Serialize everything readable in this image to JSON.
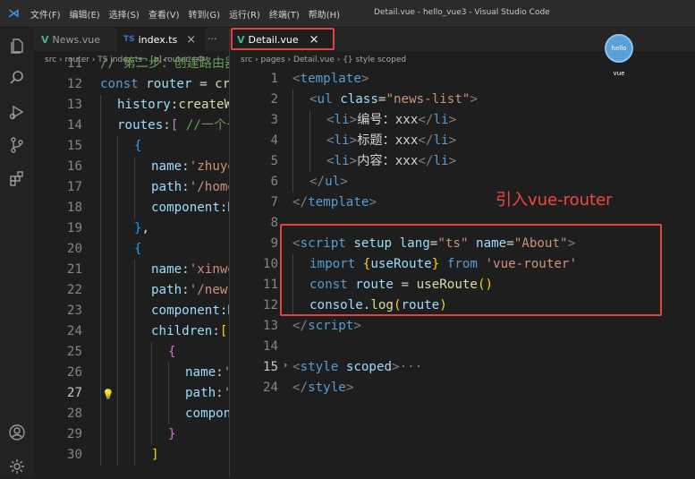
{
  "titlebar": {
    "menu": [
      "文件(F)",
      "编辑(E)",
      "选择(S)",
      "查看(V)",
      "转到(G)",
      "运行(R)",
      "终端(T)",
      "帮助(H)"
    ],
    "window_title": "Detail.vue - hello_vue3 - Visual Studio Code"
  },
  "left_pane": {
    "tabs": [
      {
        "label": "News.vue"
      },
      {
        "label": "index.ts"
      }
    ],
    "tab_close": "×",
    "tab_more": "···",
    "breadcrumb": "src › router › TS index.ts › [ø] router › ⚙",
    "lines": [
      {
        "n": "11",
        "indent": 0,
        "html": "<span class='cm'>// 第二步：创建路由器</span>"
      },
      {
        "n": "12",
        "indent": 0,
        "html": "<span class='kw'>const</span> <span class='vr'>router</span> <span class='wt'>=</span> <span class='fn'>createRouter</span>"
      },
      {
        "n": "13",
        "indent": 1,
        "html": "<span class='vr'>history</span><span class='wt'>:</span><span class='fn'>createWebHistory</span>"
      },
      {
        "n": "14",
        "indent": 1,
        "html": "<span class='vr'>routes</span><span class='wt'>:</span><span class='br2'>[</span> <span class='cm'>//一个一个的路由规则</span>"
      },
      {
        "n": "15",
        "indent": 2,
        "html": "<span class='br3'>{</span>"
      },
      {
        "n": "16",
        "indent": 3,
        "html": "<span class='vr'>name</span><span class='wt'>:</span><span class='st'>'zhuye'</span>"
      },
      {
        "n": "17",
        "indent": 3,
        "html": "<span class='vr'>path</span><span class='wt'>:</span><span class='st'>'/home'</span>"
      },
      {
        "n": "18",
        "indent": 3,
        "html": "<span class='vr'>component</span><span class='wt'>:</span><span class='vr'>Home</span>"
      },
      {
        "n": "19",
        "indent": 2,
        "html": "<span class='br3'>}</span><span class='wt'>,</span>"
      },
      {
        "n": "20",
        "indent": 2,
        "html": "<span class='br3'>{</span>"
      },
      {
        "n": "21",
        "indent": 3,
        "html": "<span class='vr'>name</span><span class='wt'>:</span><span class='st'>'xinwen'</span>"
      },
      {
        "n": "22",
        "indent": 3,
        "html": "<span class='vr'>path</span><span class='wt'>:</span><span class='st'>'/news'</span>"
      },
      {
        "n": "23",
        "indent": 3,
        "html": "<span class='vr'>component</span><span class='wt'>:</span><span class='vr'>News</span>"
      },
      {
        "n": "24",
        "indent": 3,
        "html": "<span class='vr'>children</span><span class='wt'>:</span><span class='br1'>[</span>"
      },
      {
        "n": "25",
        "indent": 4,
        "html": "<span class='br2'>{</span>"
      },
      {
        "n": "26",
        "indent": 5,
        "html": "<span class='vr'>name</span><span class='wt'>:</span><span class='st'>'xiang'</span>"
      },
      {
        "n": "27",
        "indent": 5,
        "html": "<span class='vr'>path</span><span class='wt'>:</span><span class='st'>'detail'</span>"
      },
      {
        "n": "28",
        "indent": 5,
        "html": "<span class='vr'>component</span><span class='wt'>:</span><span class='vr'>Detail</span>"
      },
      {
        "n": "29",
        "indent": 4,
        "html": "<span class='br2'>}</span>"
      },
      {
        "n": "30",
        "indent": 3,
        "html": "<span class='br1'>]</span>"
      }
    ]
  },
  "right_pane": {
    "tab": {
      "label": "Detail.vue"
    },
    "tab_close": "×",
    "breadcrumb": "src › pages › Detail.vue › {} style scoped",
    "lines": [
      {
        "n": "1",
        "indent": 0,
        "html": "<span class='pn'>&lt;</span><span class='tg'>template</span><span class='pn'>&gt;</span>"
      },
      {
        "n": "2",
        "indent": 1,
        "html": "<span class='pn'>&lt;</span><span class='tg'>ul</span> <span class='at'>class</span><span class='wt'>=</span><span class='st'>\"news-list\"</span><span class='pn'>&gt;</span>"
      },
      {
        "n": "3",
        "indent": 2,
        "html": "<span class='pn'>&lt;</span><span class='tg'>li</span><span class='pn'>&gt;</span><span class='wt'>编号：xxx</span><span class='pn'>&lt;/</span><span class='tg'>li</span><span class='pn'>&gt;</span>"
      },
      {
        "n": "4",
        "indent": 2,
        "html": "<span class='pn'>&lt;</span><span class='tg'>li</span><span class='pn'>&gt;</span><span class='wt'>标题：xxx</span><span class='pn'>&lt;/</span><span class='tg'>li</span><span class='pn'>&gt;</span>"
      },
      {
        "n": "5",
        "indent": 2,
        "html": "<span class='pn'>&lt;</span><span class='tg'>li</span><span class='pn'>&gt;</span><span class='wt'>内容：xxx</span><span class='pn'>&lt;/</span><span class='tg'>li</span><span class='pn'>&gt;</span>"
      },
      {
        "n": "6",
        "indent": 1,
        "html": "<span class='pn'>&lt;/</span><span class='tg'>ul</span><span class='pn'>&gt;</span>"
      },
      {
        "n": "7",
        "indent": 0,
        "html": "<span class='pn'>&lt;/</span><span class='tg'>template</span><span class='pn'>&gt;</span>"
      },
      {
        "n": "8",
        "indent": 0,
        "html": ""
      },
      {
        "n": "9",
        "indent": 0,
        "html": "<span class='pn'>&lt;</span><span class='tg'>script</span> <span class='at'>setup</span> <span class='at'>lang</span><span class='wt'>=</span><span class='st'>\"ts\"</span> <span class='at'>name</span><span class='wt'>=</span><span class='st'>\"About\"</span><span class='pn'>&gt;</span>"
      },
      {
        "n": "10",
        "indent": 1,
        "html": "<span class='kw'>import</span> <span class='br1'>{</span><span class='vr'>useRoute</span><span class='br1'>}</span> <span class='kw'>from</span> <span class='st'>'vue-router'</span>"
      },
      {
        "n": "11",
        "indent": 1,
        "html": "<span class='kw'>const</span> <span class='vr'>route</span> <span class='wt'>=</span> <span class='fn'>useRoute</span><span class='br1'>()</span>"
      },
      {
        "n": "12",
        "indent": 1,
        "html": "<span class='vr'>console</span><span class='wt'>.</span><span class='fn'>log</span><span class='br1'>(</span><span class='vr'>route</span><span class='br1'>)</span>"
      },
      {
        "n": "13",
        "indent": 0,
        "html": "<span class='pn'>&lt;/</span><span class='tg'>script</span><span class='pn'>&gt;</span>"
      },
      {
        "n": "14",
        "indent": 0,
        "html": ""
      },
      {
        "n": "15",
        "indent": 0,
        "html": "<span class='pn'>&lt;</span><span class='tg'>style</span> <span class='at'>scoped</span><span class='pn'>&gt;</span><span class='pn'>···</span>"
      },
      {
        "n": "24",
        "indent": 0,
        "html": "<span class='pn'>&lt;/</span><span class='tg'>style</span><span class='pn'>&gt;</span>"
      }
    ]
  },
  "annotation": "引入vue-router",
  "avatar_label": "hello vue",
  "colors": {
    "annotation": "#f0493d",
    "vue_green": "#41b883",
    "ts_blue": "#3178c6"
  },
  "icons": [
    "vscode-logo-icon",
    "explorer-icon",
    "search-icon",
    "run-debug-icon",
    "source-control-icon",
    "extensions-icon",
    "account-icon",
    "settings-gear-icon"
  ]
}
